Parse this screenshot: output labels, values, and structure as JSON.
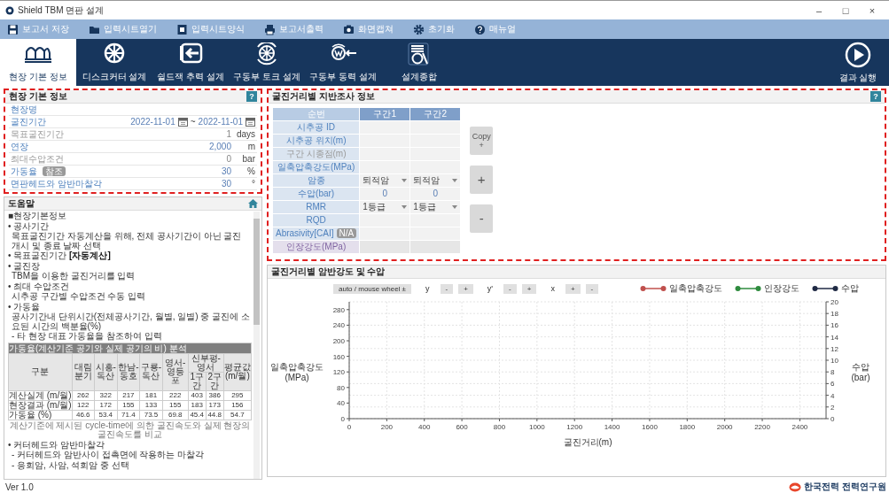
{
  "window": {
    "title": "Shield TBM 면판 설계",
    "controls": [
      "–",
      "□",
      "×"
    ]
  },
  "toolbar": [
    {
      "kind": "save",
      "label": "보고서 저장"
    },
    {
      "kind": "open",
      "label": "입력시트열기"
    },
    {
      "kind": "sheet",
      "label": "입력시트양식"
    },
    {
      "kind": "print",
      "label": "보고서출력"
    },
    {
      "kind": "capture",
      "label": "화면캡쳐"
    },
    {
      "kind": "reset",
      "label": "초기화"
    },
    {
      "kind": "manual",
      "label": "매뉴얼"
    }
  ],
  "nav_tabs": [
    {
      "kind": "site",
      "label": "현장 기본 정보",
      "selected": true
    },
    {
      "kind": "disc",
      "label": "디스크커터 설계",
      "selected": false
    },
    {
      "kind": "jack",
      "label": "쉴드잭 추력 설계",
      "selected": false
    },
    {
      "kind": "torque",
      "label": "구동부 토크 설계",
      "selected": false
    },
    {
      "kind": "power",
      "label": "구동부 동력 설계",
      "selected": false
    },
    {
      "kind": "summary",
      "label": "설계종합",
      "selected": false
    }
  ],
  "run_button": {
    "label": "결과 실행"
  },
  "site_info": {
    "title": "현장 기본 정보",
    "help": "?",
    "highlighted": true,
    "fields": [
      {
        "kind": "text",
        "label": "현장명",
        "disabled": false
      },
      {
        "kind": "date_range",
        "label": "굴진기간",
        "start": "2022-11-01",
        "separator": "~",
        "end": "2022-11-01",
        "disabled": false
      },
      {
        "kind": "number",
        "label": "목표굴진기간",
        "value": "1",
        "unit": "days",
        "disabled": true
      },
      {
        "kind": "number",
        "label": "연장",
        "value": "2,000",
        "unit": "m",
        "disabled": false
      },
      {
        "kind": "number",
        "label": "최대수압조건",
        "value": "0",
        "unit": "bar",
        "disabled": true
      },
      {
        "kind": "number",
        "label": "가동율",
        "badge": "참조",
        "value": "30",
        "unit": "%",
        "disabled": false
      },
      {
        "kind": "number",
        "label": "면판헤드와 암반마찰각",
        "value": "30",
        "unit": "°",
        "disabled": false
      }
    ]
  },
  "help": {
    "title": "도움말",
    "items": [
      {
        "kind": "heading",
        "text": "■현장기본정보"
      },
      {
        "kind": "bullet",
        "title": "• 공사기간",
        "lines": [
          "목표굴진기간 자동계산을 위해, 전체 공사기간이 아닌 굴진 개시 및 종료 날짜 선택"
        ]
      },
      {
        "kind": "bullet",
        "title": "• 목표굴진기간 **[자동계산]**"
      },
      {
        "kind": "bullet",
        "title": "• 굴진장",
        "lines": [
          "TBM을 이용한 굴진거리를 입력"
        ]
      },
      {
        "kind": "bullet",
        "title": "• 최대 수압조건",
        "lines": [
          "시추공 구간별 수압조건 수동 입력"
        ]
      },
      {
        "kind": "bullet",
        "title": "• 가동율",
        "lines": [
          "공사기간내 단위시간(전체공사기간, 월별, 일별) 중 굴진에 소요된 시간의 백분율(%)",
          " - 타 현장 대표 가동율을 참조하여 입력"
        ]
      },
      {
        "kind": "table",
        "title": "가동율(계산기준 공기와 실제 공기의 비) 분석",
        "header": [
          [
            {
              "label": "구분",
              "rowspan": 2
            },
            {
              "label": "대림 분기",
              "rowspan": 2
            },
            {
              "label": "시흥-독산",
              "rowspan": 2
            },
            {
              "label": "한남-동호",
              "rowspan": 2
            },
            {
              "label": "구룡-독산",
              "rowspan": 2
            },
            {
              "label": "영서-영등포",
              "rowspan": 2
            },
            {
              "label": "신부평-영서",
              "colspan": 2
            },
            {
              "label": "평균값 (m/월)",
              "rowspan": 2
            }
          ],
          [
            {
              "label": "1구간"
            },
            {
              "label": "2구간"
            }
          ]
        ],
        "rows": [
          [
            "계산실계 (m/월)",
            "262",
            "322",
            "217",
            "181",
            "222",
            "403",
            "386",
            "295"
          ],
          [
            "현장결과 (m/월)",
            "122",
            "172",
            "155",
            "133",
            "155",
            "183",
            "173",
            "156"
          ],
          [
            "가동율 (%)",
            "46.6",
            "53.4",
            "71.4",
            "73.5",
            "69.8",
            "45.4",
            "44.8",
            "54.7"
          ]
        ],
        "note": "계산기준에 제시된 cycle-time에 의한 굴진속도와 실제 현장의 굴진속도를 비교"
      },
      {
        "kind": "bullet",
        "title": "• 커터헤드와 암반마찰각",
        "lines": [
          "- 커터헤드와 암반사이 접촉면에 작용하는 마찰각",
          "- 응회암, 사암, 석회암 중 선택"
        ]
      }
    ]
  },
  "version": "Ver 1.0",
  "survey": {
    "title": "굴진거리별 지반조사 정보",
    "help": "?",
    "highlighted": true,
    "corner": "순번",
    "sections": [
      "구간1",
      "구간2"
    ],
    "rows": [
      {
        "label": "시추공 ID",
        "kind": "input",
        "disabled": false
      },
      {
        "label": "시추공 위치(m)",
        "kind": "input",
        "disabled": false
      },
      {
        "label": "구간 시종점(m)",
        "kind": "input",
        "disabled": true
      },
      {
        "label": "일축압축강도(MPa)",
        "kind": "input",
        "disabled": false
      },
      {
        "label": "암종",
        "kind": "select",
        "values": [
          "퇴적암",
          "퇴적암"
        ],
        "disabled": false
      },
      {
        "label": "수압(bar)",
        "kind": "value",
        "values": [
          "0",
          "0"
        ],
        "disabled": false
      },
      {
        "label": "RMR",
        "kind": "select",
        "values": [
          "1등급",
          "1등급"
        ],
        "disabled": false
      },
      {
        "label": "RQD",
        "kind": "input",
        "disabled": false
      },
      {
        "label": "Abrasivity[CAI]",
        "badge": "N/A",
        "kind": "input",
        "disabled": false
      },
      {
        "label": "인장강도(MPa)",
        "kind": "computed",
        "disabled": false
      }
    ],
    "side_buttons": [
      {
        "kind": "copy",
        "label": "Copy",
        "symbol": "+",
        "disabled": true
      },
      {
        "kind": "add",
        "symbol": "+",
        "disabled": true
      },
      {
        "kind": "remove",
        "symbol": "-",
        "disabled": true
      }
    ]
  },
  "strength_chart": {
    "title": "굴진거리별 암반강도 및 수압",
    "controls": [
      {
        "kind": "button",
        "label": "auto / mouse wheel ±"
      },
      {
        "kind": "axis",
        "label": "y"
      },
      {
        "kind": "button",
        "label": "-"
      },
      {
        "kind": "button",
        "label": "+"
      },
      {
        "kind": "axis",
        "label": "y'"
      },
      {
        "kind": "button",
        "label": "-"
      },
      {
        "kind": "button",
        "label": "+"
      },
      {
        "kind": "axis",
        "label": "x"
      },
      {
        "kind": "button",
        "label": "+"
      },
      {
        "kind": "button",
        "label": "-"
      }
    ],
    "legend": [
      {
        "name": "일축압축강도",
        "color": "#c0504d"
      },
      {
        "name": "인장강도",
        "color": "#2e8b3e"
      },
      {
        "name": "수압",
        "color": "#1f2a44"
      }
    ],
    "x_axis": {
      "label": "굴진거리(m)",
      "ticks": [
        "0",
        "200",
        "400",
        "600",
        "800",
        "1000",
        "1200",
        "1400",
        "1600",
        "1800",
        "2000",
        "2200",
        "2400"
      ]
    },
    "y_axis": {
      "label": "일축압축강도 (MPa)",
      "ticks": [
        "280",
        "240",
        "200",
        "160",
        "120",
        "80",
        "40",
        "0"
      ]
    },
    "y2_axis": {
      "label": "수압 (bar)",
      "ticks": [
        "20",
        "18",
        "16",
        "14",
        "12",
        "10",
        "8",
        "6",
        "4",
        "2",
        "0"
      ]
    }
  },
  "logo": {
    "company": "한국전력",
    "institute": "전력연구원"
  }
}
